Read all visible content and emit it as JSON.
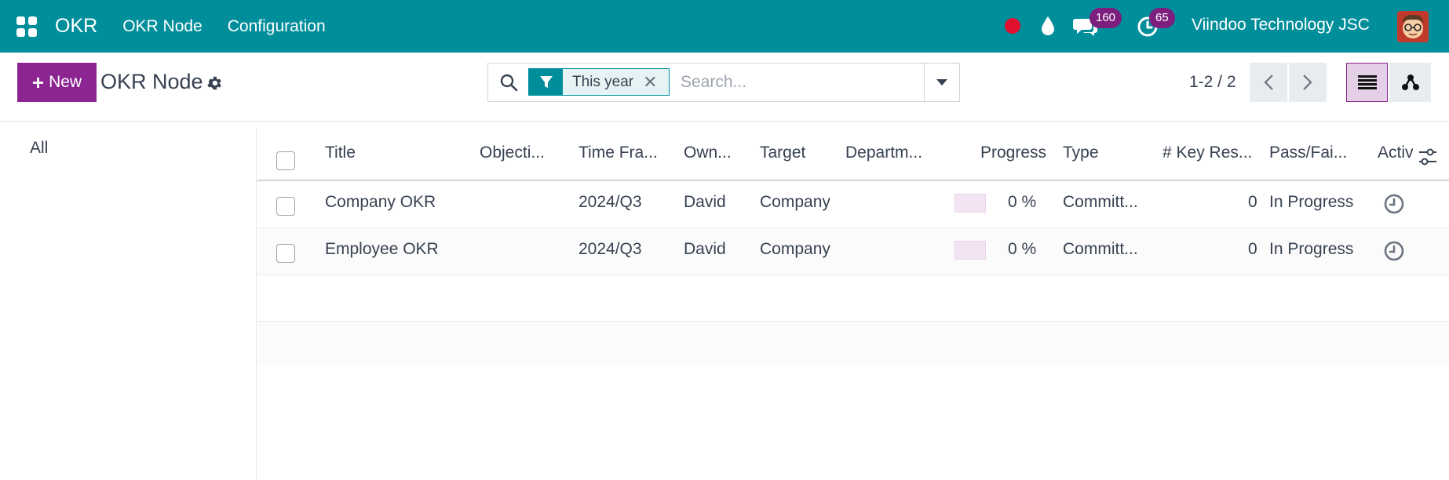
{
  "navbar": {
    "app_name": "OKR",
    "menu": [
      "OKR Node",
      "Configuration"
    ],
    "chat_badge": "160",
    "activity_badge": "65",
    "company": "Viindoo Technology JSC",
    "colors": {
      "bg": "#018e9b",
      "badge": "#7c1f7f",
      "record": "#e0102e"
    },
    "icons": [
      "apps-icon",
      "record-icon",
      "drop-icon",
      "chat-icon",
      "activity-clock-icon",
      "avatar"
    ]
  },
  "control": {
    "new_label": "New",
    "title": "OKR Node",
    "search": {
      "facet": "This year",
      "placeholder": "Search..."
    },
    "pager": "1-2 / 2"
  },
  "sidebar": {
    "items": [
      {
        "label": "All"
      }
    ]
  },
  "table": {
    "columns": [
      "Title",
      "Objecti...",
      "Time Fra...",
      "Own...",
      "Target",
      "Departm...",
      "Progress",
      "Type",
      "# Key Res...",
      "Pass/Fai...",
      "Activi"
    ],
    "rows": [
      {
        "title": "Company OKR",
        "objective": "",
        "time_frame": "2024/Q3",
        "owner": "David",
        "target": "Company",
        "department": "",
        "progress": 0,
        "progress_text": "0 %",
        "type": "Committ...",
        "key_results": "0",
        "pass_fail": "In Progress"
      },
      {
        "title": "Employee OKR",
        "objective": "",
        "time_frame": "2024/Q3",
        "owner": "David",
        "target": "Company",
        "department": "",
        "progress": 0,
        "progress_text": "0 %",
        "type": "Committ...",
        "key_results": "0",
        "pass_fail": "In Progress"
      }
    ]
  },
  "colors": {
    "primary": "#8c2492"
  }
}
